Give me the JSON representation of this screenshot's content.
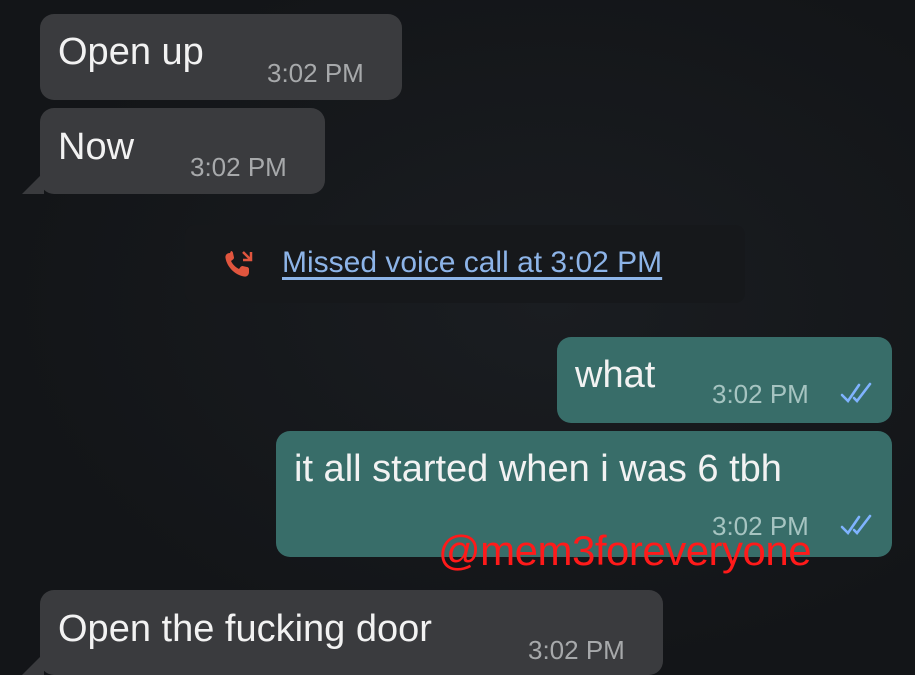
{
  "messages": {
    "m1": {
      "text": "Open up",
      "time": "3:02 PM"
    },
    "m2": {
      "text": "Now",
      "time": "3:02 PM"
    },
    "m3": {
      "text": "what",
      "time": "3:02 PM"
    },
    "m4": {
      "text": "it all started when i was 6 tbh",
      "time": "3:02 PM"
    },
    "m5": {
      "text": "Open the fucking door",
      "time": "3:02 PM"
    }
  },
  "missed_call": {
    "text": "Missed voice call at 3:02 PM",
    "icon": "missed-call-icon",
    "icon_color": "#e0553e",
    "link_color": "#8db4e8"
  },
  "watermark": {
    "text": "@mem3foreveryone",
    "color": "#ff1a1a"
  },
  "colors": {
    "background": "#141619",
    "incoming_bubble": "#3a3b3e",
    "outgoing_bubble": "#386d69",
    "read_ticks": "#7fb3ff"
  }
}
